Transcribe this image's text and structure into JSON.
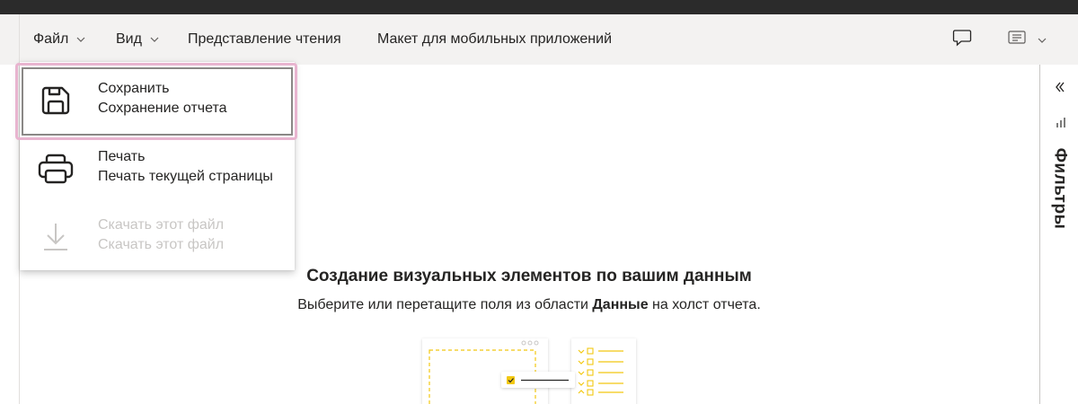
{
  "menubar": {
    "file_label": "Файл",
    "view_label": "Вид",
    "reading_view_label": "Представление чтения",
    "mobile_layout_label": "Макет для мобильных приложений",
    "comment_icon": "comment-icon",
    "bookmark_icon": "bookmark-icon"
  },
  "file_menu": {
    "items": [
      {
        "title": "Сохранить",
        "subtitle": "Сохранение отчета",
        "icon": "save-icon",
        "enabled": true,
        "focused": true
      },
      {
        "title": "Печать",
        "subtitle": "Печать текущей страницы",
        "icon": "print-icon",
        "enabled": true,
        "focused": false
      },
      {
        "title": "Скачать этот файл",
        "subtitle": "Скачать этот файл",
        "icon": "download-icon",
        "enabled": false,
        "focused": false
      }
    ]
  },
  "filters_pane": {
    "label": "Фильтры",
    "collapse_icon": "double-chevron-left-icon"
  },
  "empty_state": {
    "title": "Создание визуальных элементов по вашим данным",
    "subtitle_before": "Выберите или перетащите поля из области ",
    "subtitle_bold": "Данные",
    "subtitle_after": " на холст отчета."
  },
  "colors": {
    "accent_yellow": "#f2c811",
    "focus_pink": "#e8b4cf",
    "menubar_bg": "#f3f2f1"
  }
}
